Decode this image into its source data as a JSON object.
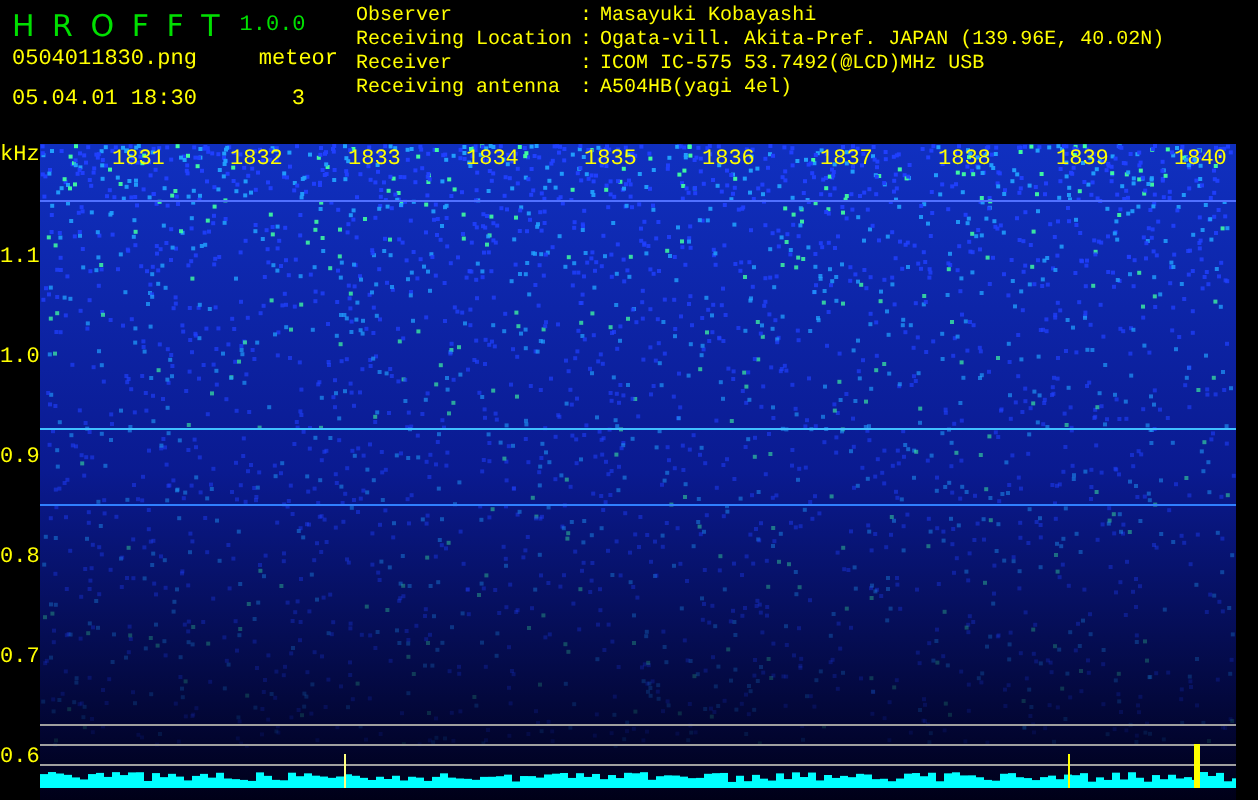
{
  "header": {
    "title": "H R O F F T",
    "version": "1.0.0",
    "file": "0504011830.png",
    "date": "05.04.01 18:30",
    "meteor_label": "meteor",
    "meteor_count": "3"
  },
  "info": [
    {
      "label": "Observer",
      "separator": ":",
      "value": "Masayuki Kobayashi"
    },
    {
      "label": "Receiving Location",
      "separator": ":",
      "value": "Ogata-vill. Akita-Pref. JAPAN (139.96E, 40.02N)"
    },
    {
      "label": "Receiver",
      "separator": ":",
      "value": "ICOM IC-575 53.7492(@LCD)MHz USB"
    },
    {
      "label": "Receiving antenna",
      "separator": ":",
      "value": "A504HB(yagi 4el)"
    }
  ],
  "plot": {
    "unit": "kHz",
    "y_labels": [
      "1.1",
      "1.0",
      "0.9",
      "0.8",
      "0.7",
      "0.6"
    ],
    "time_labels": [
      "1831",
      "1832",
      "1833",
      "1834",
      "1835",
      "1836",
      "1837",
      "1838",
      "1839",
      "1840"
    ]
  }
}
